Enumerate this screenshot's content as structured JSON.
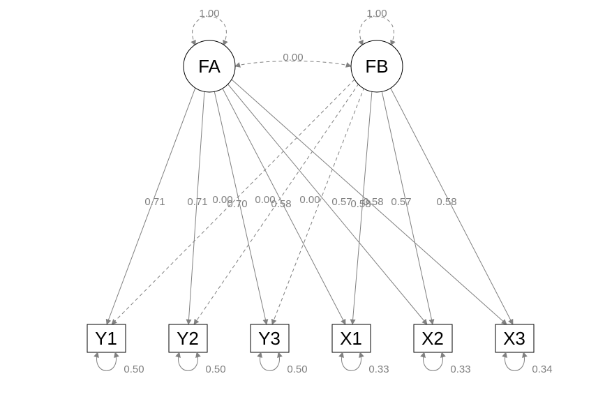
{
  "chart_data": {
    "type": "path-diagram",
    "title": "",
    "latent_nodes": [
      {
        "id": "FA",
        "label": "FA"
      },
      {
        "id": "FB",
        "label": "FB"
      }
    ],
    "observed_nodes": [
      {
        "id": "Y1",
        "label": "Y1"
      },
      {
        "id": "Y2",
        "label": "Y2"
      },
      {
        "id": "Y3",
        "label": "Y3"
      },
      {
        "id": "X1",
        "label": "X1"
      },
      {
        "id": "X2",
        "label": "X2"
      },
      {
        "id": "X3",
        "label": "X3"
      }
    ],
    "variances": {
      "FA": "1.00",
      "FB": "1.00",
      "Y1": "0.50",
      "Y2": "0.50",
      "Y3": "0.50",
      "X1": "0.33",
      "X2": "0.33",
      "X3": "0.34"
    },
    "covariance": {
      "FA_FB": "0.00"
    },
    "loadings": [
      {
        "from": "FA",
        "to": "Y1",
        "value": "0.71",
        "style": "solid"
      },
      {
        "from": "FA",
        "to": "Y2",
        "value": "0.71",
        "style": "solid"
      },
      {
        "from": "FA",
        "to": "Y3",
        "value": "0.70",
        "style": "solid"
      },
      {
        "from": "FA",
        "to": "X1",
        "value": "0.58",
        "style": "solid"
      },
      {
        "from": "FA",
        "to": "X2",
        "value": "0.57",
        "style": "solid"
      },
      {
        "from": "FA",
        "to": "X3",
        "value": "0.58",
        "style": "solid"
      },
      {
        "from": "FB",
        "to": "Y1",
        "value": "0.00",
        "style": "dashed"
      },
      {
        "from": "FB",
        "to": "Y2",
        "value": "0.00",
        "style": "dashed"
      },
      {
        "from": "FB",
        "to": "Y3",
        "value": "0.00",
        "style": "dashed"
      },
      {
        "from": "FB",
        "to": "X1",
        "value": "0.58",
        "style": "solid"
      },
      {
        "from": "FB",
        "to": "X2",
        "value": "0.57",
        "style": "solid"
      },
      {
        "from": "FB",
        "to": "X3",
        "value": "0.58",
        "style": "solid"
      }
    ]
  }
}
